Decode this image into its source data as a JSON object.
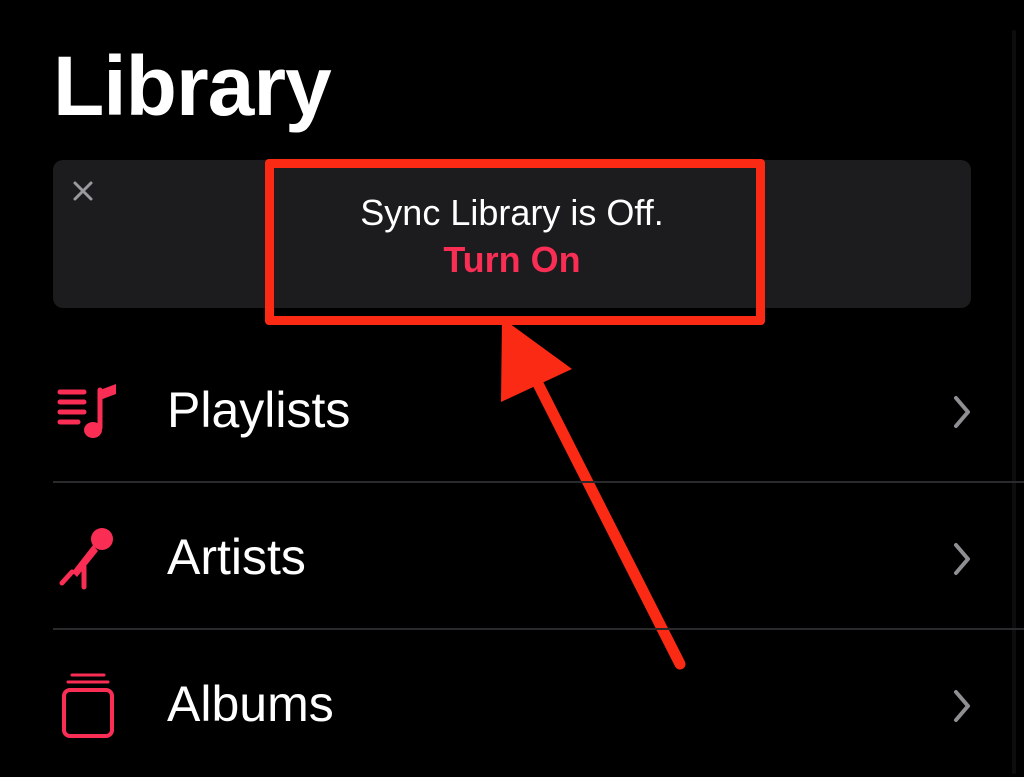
{
  "header": {
    "title": "Library"
  },
  "banner": {
    "close_icon": "close-icon",
    "message": "Sync Library is Off.",
    "action_label": "Turn On"
  },
  "library": {
    "items": [
      {
        "label": "Playlists",
        "icon": "playlists-icon"
      },
      {
        "label": "Artists",
        "icon": "microphone-icon"
      },
      {
        "label": "Albums",
        "icon": "album-stack-icon"
      }
    ]
  },
  "colors": {
    "background": "#000000",
    "banner_background": "#1c1c1e",
    "accent": "#fa2d55",
    "annotation": "#fb2a14",
    "chevron": "#8e8e93",
    "divider": "#2a2a2c"
  }
}
